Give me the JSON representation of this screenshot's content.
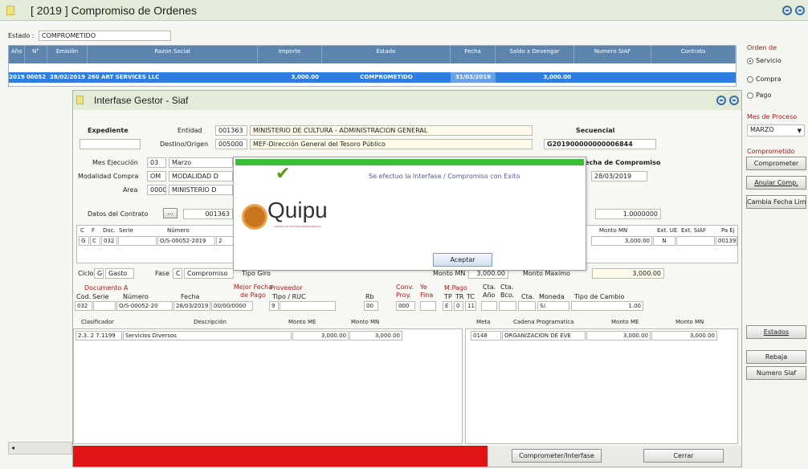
{
  "main_window": {
    "title": "[ 2019 ] Compromiso de Ordenes",
    "estado_label": "Estado :",
    "estado_value": "COMPROMETIDO"
  },
  "orders_table": {
    "headers": [
      "Año",
      "N°",
      "Emisión",
      "Razon Social",
      "Importe",
      "Estado",
      "Fecha",
      "Saldo x Devengar",
      "Numero SIAF",
      "Contrato"
    ],
    "row": [
      "2019",
      "00052",
      "28/02/2019",
      "260 ART SERVICES LLC",
      "3,000.00",
      "COMPROMETIDO",
      "31/03/2019",
      "3,000.00",
      "",
      ""
    ]
  },
  "right_panel": {
    "orden_de_label": "Orden de",
    "options": [
      "Servicio",
      "Compra",
      "Pago"
    ],
    "selected_option": "Servicio",
    "mes_proceso_label": "Mes de Proceso",
    "mes_proceso_value": "MARZO",
    "comprometido_label": "Comprometido",
    "comprometer_button": "Comprometer",
    "anular_button": "Anular Comp.",
    "cambia_fecha_button": "Cambia Fecha Lim.",
    "estados_button": "Estados",
    "rebaja_button": "Rebaja",
    "numero_siaf_button": "Numero Siaf"
  },
  "dialog": {
    "title": "Interfase Gestor - Siaf",
    "expediente_label": "Expediente",
    "expediente_value": "",
    "entidad_label": "Entidad",
    "entidad_code": "001363",
    "entidad_name": "MINISTERIO DE CULTURA - ADMINISTRACION GENERAL",
    "destino_label": "Destino/Origen",
    "destino_code": "005000",
    "destino_name": "MEF-Dirección General del Tesoro Público",
    "secuencial_label": "Secuencial",
    "secuencial_value": "G201900000000006844",
    "mes_ejecucion_label": "Mes Ejecución",
    "mes_ejecucion_code": "03",
    "mes_ejecucion_name": "Marzo",
    "modalidad_label": "Modalidad Compra",
    "modalidad_code": "OM",
    "modalidad_name": "MODALIDAD D",
    "area_label": "Area",
    "area_code": "0000",
    "area_name": "MINISTERIO D",
    "fecha_compromiso_label": "Fecha de Compromiso",
    "fecha_compromiso_value": "28/03/2019",
    "datos_contrato_label": "Datos del Contrato",
    "contrato_value": "001363",
    "tipo_cambio_value": "1.0000000",
    "doc_headers": [
      "C",
      "F",
      "Doc.",
      "Serie",
      "Número"
    ],
    "doc_row": [
      "G",
      "C",
      "032",
      "",
      "O/S-00052-2019"
    ],
    "doc_row_extra": "2",
    "right_doc_headers": [
      "Monto MN",
      "Ext. UE",
      "Ext. SIAF",
      "Pa Ej"
    ],
    "right_doc_row": [
      "3,000.00",
      "N",
      "",
      "00139"
    ],
    "ciclo_label": "Ciclo",
    "ciclo_code": "G",
    "ciclo_name": "Gasto",
    "fase_label": "Fase",
    "fase_code": "C",
    "fase_name": "Compromiso",
    "tipo_giro_label": "Tipo Giro",
    "monto_mn_label": "Monto MN",
    "monto_mn_value": "3,000.00",
    "monto_maximo_label": "Monto Maximo",
    "monto_maximo_value": "3,000.00",
    "doc_a_label": "Documento A",
    "cod_label": "Cod.",
    "serie_label": "Serie",
    "numero_label": "Número",
    "fecha_label": "Fecha",
    "mejor_fecha_label": "Mejor Fecha de Pago",
    "proveedor_label": "Proveedor",
    "tipo_ruc_label": "Tipo / RUC",
    "rb_label": "Rb",
    "conv_label": "Conv. Proy.",
    "ye_label": "Ye Fina",
    "mpago_label": "M.Pago",
    "tp_label": "TP",
    "tr_label": "TR",
    "tc_label": "TC",
    "cta_label": "Cta. Año",
    "cta2_label": "Cta. Bco.",
    "cta3_label": "Cta.",
    "moneda_label": "Moneda",
    "tipo_cambio_label": "Tipo de Cambio",
    "doc_cod": "032",
    "doc_serie": "",
    "doc_numero": "O/S-00052-20",
    "doc_fecha": "28/03/2019",
    "doc_mejor_fecha": "00/00/0000",
    "doc_tipo": "9",
    "doc_ruc": "",
    "doc_rb": "00",
    "doc_conv": "000",
    "doc_tp": "E",
    "doc_tr": "0",
    "doc_tc": "11",
    "doc_moneda": "S/.",
    "doc_tipo_cambio": "1.00",
    "clasif_headers": [
      "Clasificador",
      "Descripción",
      "Monto ME",
      "Monto MN"
    ],
    "clasif_row": [
      "2.3. 2 7.1199",
      "Servicios Diversos",
      "3,000.00",
      "3,000.00"
    ],
    "meta_headers": [
      "Meta",
      "Cadena Programatica",
      "Monto ME",
      "Monto MN"
    ],
    "meta_row": [
      "0148",
      "ORGANIZACION DE EVE",
      "3,000.00",
      "3,000.00"
    ],
    "comprometer_interfase_button": "Comprometer/Interfase",
    "cerrar_button": "Cerrar"
  },
  "message_box": {
    "message": "Se efectuo la Interfase / Compromiso con Exito",
    "accept_button": "Aceptar",
    "logo_text": "Quipu",
    "logo_subtext": "SISTEMA DE GESTION ADMINISTRATIVA"
  },
  "colors": {
    "header_blue": "#5c84ad",
    "selected_row": "#2f7de1",
    "progress_green": "#3bbf3b",
    "bottom_red": "#e01414"
  }
}
